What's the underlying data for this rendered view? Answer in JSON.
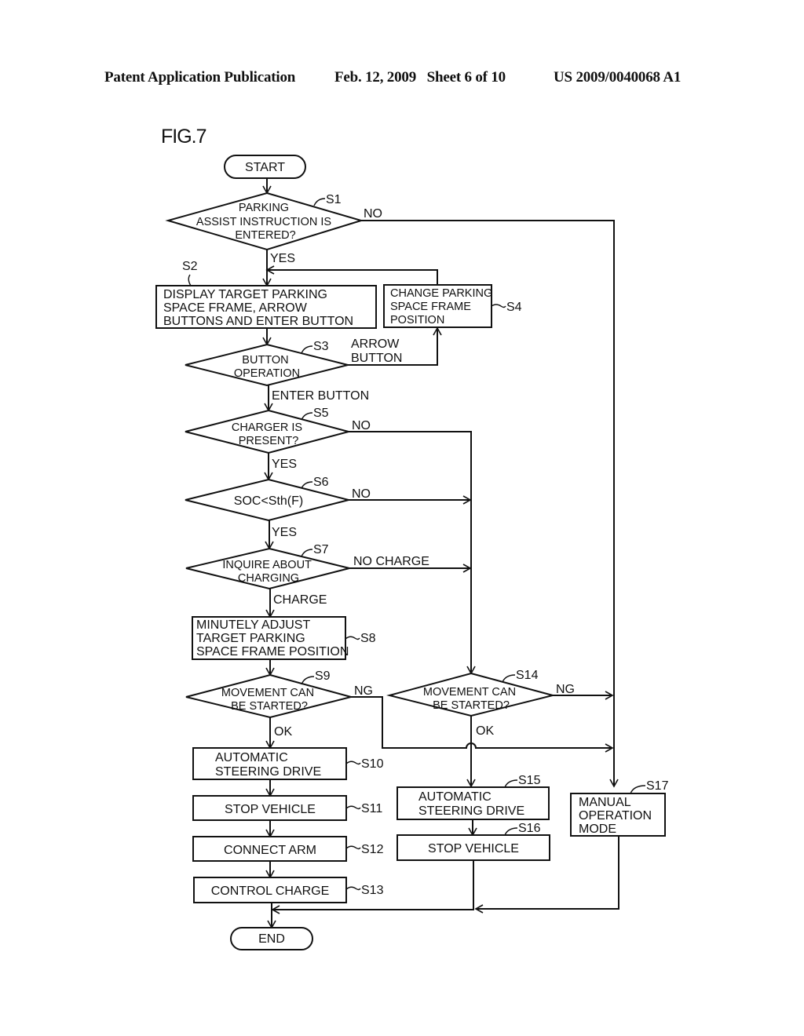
{
  "header": {
    "publication": "Patent Application Publication",
    "date_sheet": "Feb. 12, 2009   Sheet 6 of 10",
    "number": "US 2009/0040068 A1"
  },
  "figure": {
    "label": "FIG.7"
  },
  "terminals": {
    "start": "START",
    "end": "END"
  },
  "steps": {
    "s1": {
      "id": "S1",
      "lines": [
        "PARKING",
        "ASSIST INSTRUCTION IS",
        "ENTERED?"
      ]
    },
    "s2": {
      "id": "S2",
      "lines": [
        "DISPLAY TARGET PARKING",
        "SPACE FRAME, ARROW",
        "BUTTONS AND ENTER BUTTON"
      ]
    },
    "s3": {
      "id": "S3",
      "lines": [
        "BUTTON",
        "OPERATION"
      ]
    },
    "s4": {
      "id": "S4",
      "lines": [
        "CHANGE PARKING",
        "SPACE FRAME",
        "POSITION"
      ]
    },
    "s5": {
      "id": "S5",
      "lines": [
        "CHARGER IS",
        "PRESENT?"
      ]
    },
    "s6": {
      "id": "S6",
      "lines": [
        "SOC<Sth(F)"
      ]
    },
    "s7": {
      "id": "S7",
      "lines": [
        "INQUIRE ABOUT",
        "CHARGING"
      ]
    },
    "s8": {
      "id": "S8",
      "lines": [
        "MINUTELY ADJUST",
        "TARGET PARKING",
        "SPACE FRAME POSITION"
      ]
    },
    "s9": {
      "id": "S9",
      "lines": [
        "MOVEMENT CAN",
        "BE STARTED?"
      ]
    },
    "s10": {
      "id": "S10",
      "lines": [
        "AUTOMATIC",
        "STEERING DRIVE"
      ]
    },
    "s11": {
      "id": "S11",
      "lines": [
        "STOP VEHICLE"
      ]
    },
    "s12": {
      "id": "S12",
      "lines": [
        "CONNECT ARM"
      ]
    },
    "s13": {
      "id": "S13",
      "lines": [
        "CONTROL CHARGE"
      ]
    },
    "s14": {
      "id": "S14",
      "lines": [
        "MOVEMENT CAN",
        "BE STARTED?"
      ]
    },
    "s15": {
      "id": "S15",
      "lines": [
        "AUTOMATIC",
        "STEERING DRIVE"
      ]
    },
    "s16": {
      "id": "S16",
      "lines": [
        "STOP VEHICLE"
      ]
    },
    "s17": {
      "id": "S17",
      "lines": [
        "MANUAL",
        "OPERATION",
        "MODE"
      ]
    }
  },
  "branch_labels": {
    "s1_no": "NO",
    "s1_yes": "YES",
    "s3_arrow": [
      "ARROW",
      "BUTTON"
    ],
    "s3_enter": "ENTER BUTTON",
    "s5_no": "NO",
    "s5_yes": "YES",
    "s6_no": "NO",
    "s6_yes": "YES",
    "s7_no": "NO CHARGE",
    "s7_yes": "CHARGE",
    "s9_ng": "NG",
    "s9_ok": "OK",
    "s14_ng": "NG",
    "s14_ok": "OK"
  }
}
